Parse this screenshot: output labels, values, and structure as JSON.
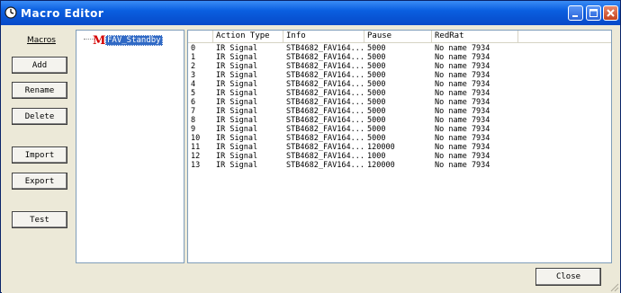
{
  "window": {
    "title": "Macro Editor",
    "colors": {
      "titlebar": "#0a5fe0",
      "close": "#c5421c",
      "selection": "#316ac5",
      "macro_icon": "#d40000"
    }
  },
  "sidebar": {
    "label": "Macros",
    "buttons": {
      "add": "Add",
      "rename": "Rename",
      "delete": "Delete",
      "import": "Import",
      "export": "Export",
      "test": "Test"
    }
  },
  "tree": {
    "icon_letter": "M",
    "selected_node": "FAV_Standby"
  },
  "table": {
    "columns": [
      "",
      "Action Type",
      "Info",
      "Pause",
      "RedRat"
    ],
    "rows": [
      [
        "0",
        "IR Signal",
        "STB4682_FAV164...",
        "5000",
        "No name 7934"
      ],
      [
        "1",
        "IR Signal",
        "STB4682_FAV164...",
        "5000",
        "No name 7934"
      ],
      [
        "2",
        "IR Signal",
        "STB4682_FAV164...",
        "5000",
        "No name 7934"
      ],
      [
        "3",
        "IR Signal",
        "STB4682_FAV164...",
        "5000",
        "No name 7934"
      ],
      [
        "4",
        "IR Signal",
        "STB4682_FAV164...",
        "5000",
        "No name 7934"
      ],
      [
        "5",
        "IR Signal",
        "STB4682_FAV164...",
        "5000",
        "No name 7934"
      ],
      [
        "6",
        "IR Signal",
        "STB4682_FAV164...",
        "5000",
        "No name 7934"
      ],
      [
        "7",
        "IR Signal",
        "STB4682_FAV164...",
        "5000",
        "No name 7934"
      ],
      [
        "8",
        "IR Signal",
        "STB4682_FAV164...",
        "5000",
        "No name 7934"
      ],
      [
        "9",
        "IR Signal",
        "STB4682_FAV164...",
        "5000",
        "No name 7934"
      ],
      [
        "10",
        "IR Signal",
        "STB4682_FAV164...",
        "5000",
        "No name 7934"
      ],
      [
        "11",
        "IR Signal",
        "STB4682_FAV164...",
        "120000",
        "No name 7934"
      ],
      [
        "12",
        "IR Signal",
        "STB4682_FAV164...",
        "1000",
        "No name 7934"
      ],
      [
        "13",
        "IR Signal",
        "STB4682_FAV164...",
        "120000",
        "No name 7934"
      ]
    ]
  },
  "footer": {
    "close": "Close"
  }
}
